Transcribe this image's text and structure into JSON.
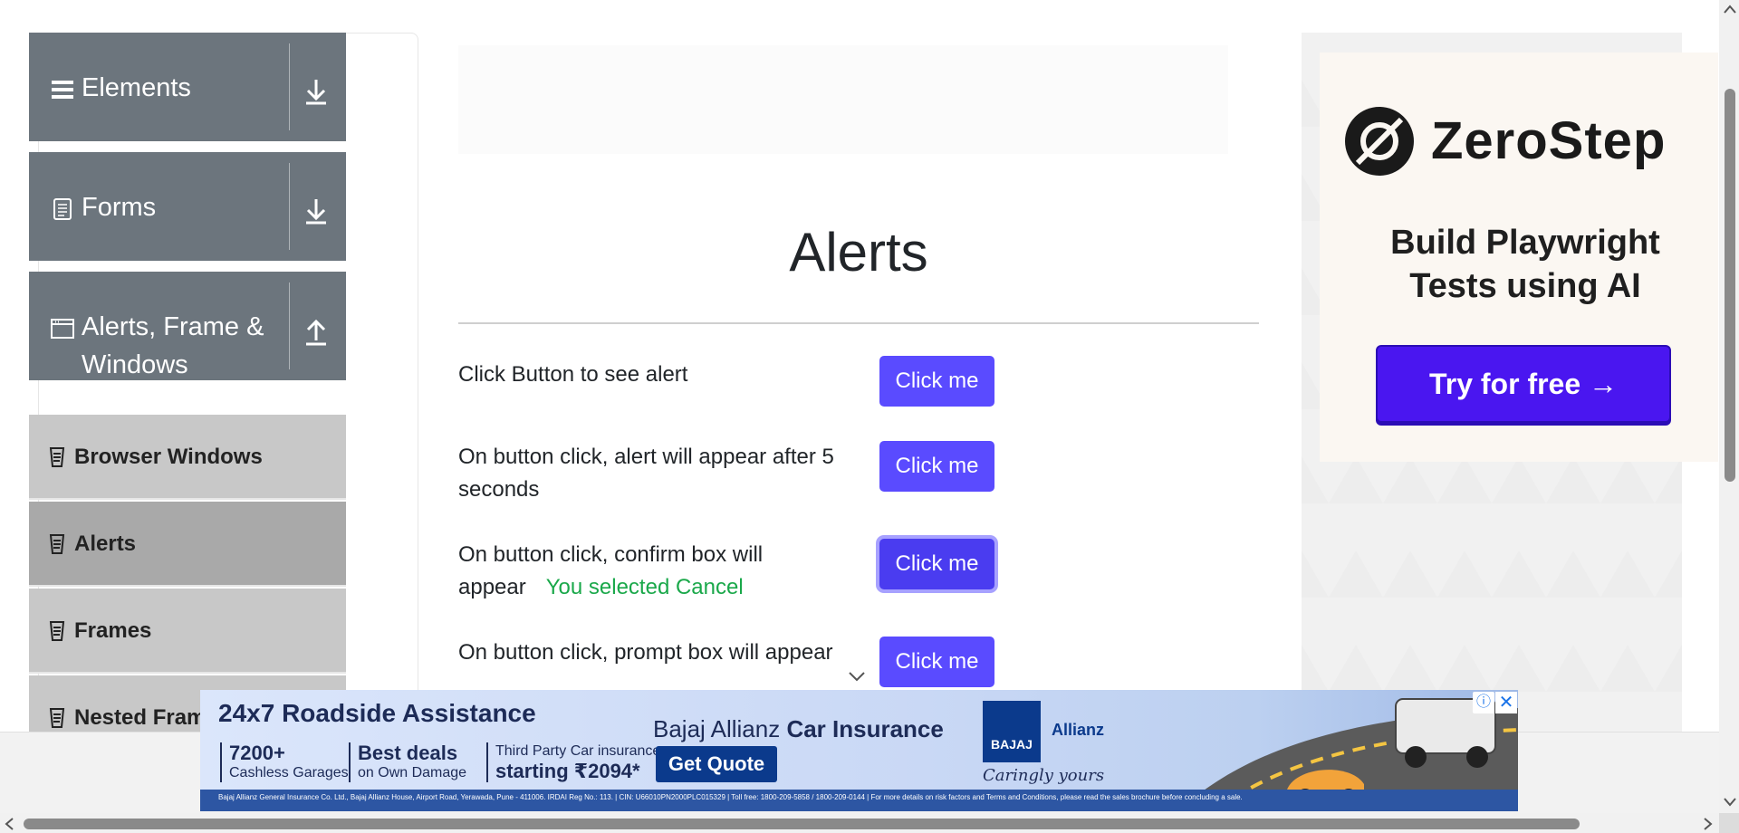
{
  "sidebar": {
    "groups": [
      {
        "label": "Elements",
        "icon": "hamburger-icon",
        "toggle": "download-arrow-icon"
      },
      {
        "label": "Forms",
        "icon": "document-icon",
        "toggle": "download-arrow-icon"
      },
      {
        "label": "Alerts, Frame & Windows",
        "icon": "window-icon",
        "toggle": "upload-arrow-icon"
      }
    ],
    "items": [
      {
        "label": "Browser Windows",
        "active": false
      },
      {
        "label": "Alerts",
        "active": true
      },
      {
        "label": "Frames",
        "active": false
      },
      {
        "label": "Nested Frames",
        "active": false
      }
    ]
  },
  "main": {
    "title": "Alerts",
    "rows": [
      {
        "label": "Click Button to see alert",
        "button": "Click me"
      },
      {
        "label": "On button click, alert will appear after 5 seconds",
        "button": "Click me"
      },
      {
        "label": "On button click, confirm box will appear",
        "result": "You selected Cancel",
        "button": "Click me"
      },
      {
        "label": "On button click, prompt box will appear",
        "button": "Click me"
      }
    ]
  },
  "right_ad": {
    "brand": "ZeroStep",
    "tagline": "Build Playwright Tests using AI",
    "cta": "Try for free →"
  },
  "bottom_ad": {
    "headline": "24x7 Roadside Assistance",
    "col1_big": "7200+",
    "col1_small": "Cashless Garages",
    "col2_big": "Best deals",
    "col2_small": "on Own Damage",
    "col3_small": "Third Party Car insurance",
    "col3_big": "starting ₹2094*",
    "brand_prefix": "Bajaj Allianz",
    "brand_product": "Car Insurance",
    "cta": "Get Quote",
    "logo_text": "BAJAJ",
    "partner": "Allianz",
    "slogan": "Caringly yours",
    "fine_print": "Bajaj Allianz General Insurance Co. Ltd., Bajaj Allianz House, Airport Road, Yerawada, Pune - 411006. IRDAI Reg No.: 113. | CIN: U66010PN2000PLC015329 | Toll free: 1800-209-5858 / 1800-209-0144 | For more details on risk factors and Terms and Conditions, please read the sales brochure before concluding a sale.",
    "info_glyph": "ⓘ",
    "close_glyph": "✕"
  },
  "colors": {
    "nav_group": "#6c757d",
    "nav_item": "#c8c8c8",
    "nav_item_active": "#a9a9a9",
    "button": "#5a4bff",
    "result_text": "#1aa84a",
    "cta_purple": "#4a16f0"
  }
}
